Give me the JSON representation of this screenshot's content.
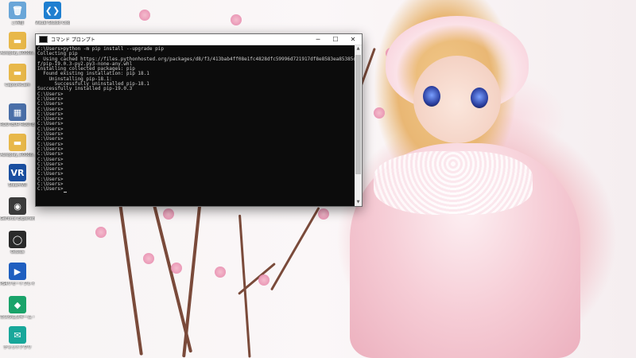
{
  "desktop": {
    "icons": [
      {
        "label": "ごみ箱",
        "icon": "recycle-bin-icon",
        "color": "#6aa6d8"
      },
      {
        "label": "Visual Studio Code",
        "icon": "vscode-icon",
        "color": "#1f7fd0"
      },
      {
        "label": "Autoplay_R0008...",
        "icon": "folder-icon",
        "color": "#e8b84a"
      },
      {
        "label": "CaptureCam",
        "icon": "folder-icon",
        "color": "#e8b84a"
      },
      {
        "label": "ROUTEUR ROUTE Reserve 3 (Invitation)",
        "icon": "shortcut-icon",
        "color": "#4a6fa8"
      },
      {
        "label": "Autoplay_R0008...",
        "icon": "folder-icon",
        "color": "#e8b84a"
      },
      {
        "label": "SteamVR",
        "icon": "vr-icon",
        "color": "#1b4fa0"
      },
      {
        "label": "GeForce Experience",
        "icon": "nvidia-icon",
        "color": "#3b3b3b"
      },
      {
        "label": "Oculus",
        "icon": "oculus-icon",
        "color": "#2a2a2a"
      },
      {
        "label": "PS4リモートプレイ",
        "icon": "ps4-remote-play-icon",
        "color": "#1f5fc0"
      },
      {
        "label": "カスタムスキーム・インプット ヘルプ",
        "icon": "app-icon",
        "color": "#1aa36a"
      },
      {
        "label": "チャットアプリ",
        "icon": "chat-app-icon",
        "color": "#18a79a"
      }
    ]
  },
  "console": {
    "title": "コマンド プロンプト",
    "controls": {
      "minimize": "─",
      "maximize": "☐",
      "close": "✕"
    },
    "lines": [
      "C:\\Users>python -m pip install --upgrade pip",
      "Collecting pip",
      "  Using cached https://files.pythonhosted.org/packages/d8/f3/413bab4ff08e1fc4828dfc59996d721917df8e8583ea85385d51125dcef",
      "f/pip-19.0.3-py2.py3-none-any.whl",
      "Installing collected packages: pip",
      "  Found existing installation: pip 18.1",
      "    Uninstalling pip-18.1:",
      "      Successfully uninstalled pip-18.1",
      "Successfully installed pip-19.0.3",
      "",
      "C:\\Users>",
      "C:\\Users>",
      "C:\\Users>",
      "C:\\Users>",
      "C:\\Users>",
      "C:\\Users>",
      "C:\\Users>",
      "C:\\Users>",
      "C:\\Users>",
      "C:\\Users>",
      "C:\\Users>",
      "C:\\Users>",
      "C:\\Users>",
      "C:\\Users>",
      "C:\\Users>",
      "C:\\Users>",
      "C:\\Users>",
      "C:\\Users>",
      "C:\\Users>",
      "C:\\Users>"
    ]
  },
  "colors": {
    "console_bg": "#0c0c0c",
    "console_text": "#cccccc",
    "titlebar": "#ffffff"
  }
}
